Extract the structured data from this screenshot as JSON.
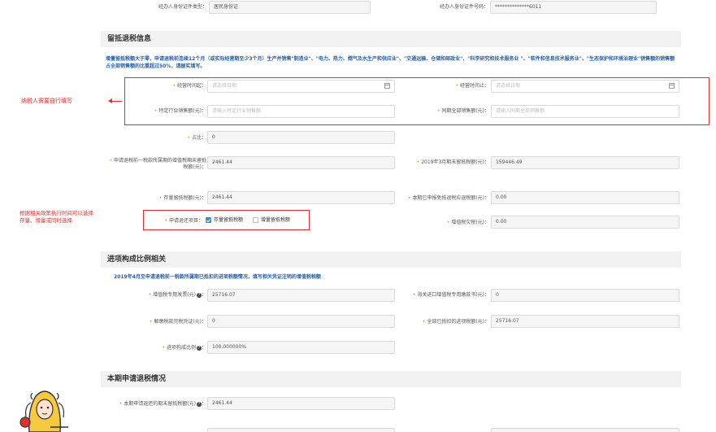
{
  "top": {
    "agent_id_type_label": "经办人身份证件类型：",
    "agent_id_type_value": "居民身份证",
    "agent_id_no_label": "经办人身份证件号码：",
    "agent_id_no_value": "**************6011"
  },
  "sec1": {
    "title": "留抵退税信息",
    "note": "增量留抵税额大于零，申请退税前连续12个月（或实际经营期至少3个月）生产并销售\"制造业\"、\"电力、热力、燃气及水生产和供应业\"、\"交通运输、仓储和邮政业\"、\"科学研究和技术服务业 \"、\"软件和信息技术服务业\"、\"生态保护和环境治理业\"销售额的销售额占全部销售额的比重超过50%，请据实填写。",
    "period_start_label": "经营时间起：",
    "period_start_placeholder": "请选择日期",
    "period_end_label": "经营时间止：",
    "period_end_placeholder": "请选择日期",
    "industry_sales_label": "特定行业销售额(元)：",
    "industry_sales_placeholder": "请输入特定行业销售额",
    "total_sales_label": "同期全部销售额(元)：",
    "total_sales_placeholder": "请输入同期全部销售额",
    "ratio_label": "占比：",
    "ratio_value": "0",
    "end_credit_label": "申请退税前一税款所属期的增值税期末留抵税额(元)：",
    "end_credit_value": "2461.44",
    "march_credit_label": "2019年3月期末留抵税额(元)：",
    "march_credit_value": "159446.49",
    "stock_credit_label": "存量留抵税额(元)：",
    "stock_credit_value": "2461.44",
    "declared_exempt_label": "本期已申报免抵退税应退税额(元)：",
    "declared_exempt_value": "0.00",
    "refund_item_label": "申请退还项目：",
    "refund_opt1": "存量留抵税额",
    "refund_opt2": "增量留抵税额",
    "vat_owed_label": "增值税欠税(元)：",
    "vat_owed_value": "0.00"
  },
  "annotations": {
    "a1": "纳税人需要自行填写",
    "a2_line1": "根据相关政策执行时间可以选择",
    "a2_line2": "存量、增量或同时选择"
  },
  "sec2": {
    "title": "进项构成比例相关",
    "note": "2019年4月至申请退税前一税款所属期已抵扣的进项税额情况，填写相关凭证注明的增值税税额",
    "special_invoice_label": "增值税专用发票(元)",
    "special_invoice_value": "25716.07",
    "customs_label": "海关进口增值税专用缴款书(元)：",
    "customs_value": "0",
    "tax_receipt_label": "解缴税款完税凭证(元)：",
    "tax_receipt_value": "0",
    "all_input_label": "全部已抵扣的进项税额(元)：",
    "all_input_value": "25716.07",
    "input_ratio_label": "进项构成比例",
    "input_ratio_value": "100.000000%"
  },
  "sec3": {
    "title": "本期申请退税情况",
    "apply_label": "本期申请退还的期末留抵税额(元)",
    "apply_value": "2461.44"
  },
  "icons": {
    "help": "help-icon",
    "calendar": "calendar-icon",
    "arrow": "arrow-left-icon",
    "mascot": "mascot-avatar"
  },
  "colors": {
    "required": "#f08a24",
    "accent_blue": "#1f5fb8",
    "annotation_red": "#e0302a",
    "checkbox": "#2d8cf0"
  }
}
